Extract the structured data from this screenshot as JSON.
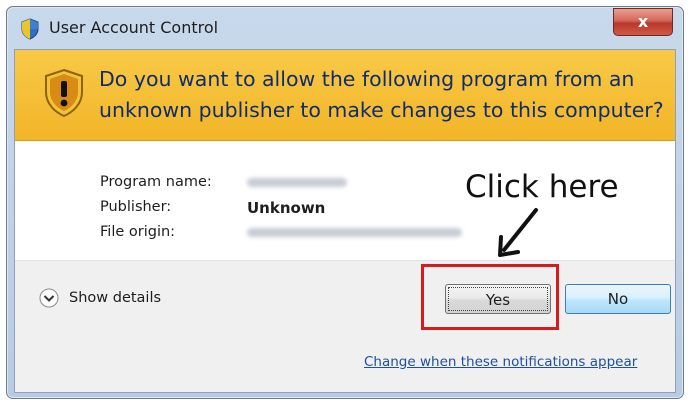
{
  "window": {
    "title": "User Account Control",
    "close_glyph": "x"
  },
  "banner": {
    "question": "Do you want to allow the following program from an unknown publisher to make changes to this computer?",
    "icon": "shield-warning-icon"
  },
  "program_info": {
    "program_name_label": "Program name:",
    "publisher_label": "Publisher:",
    "publisher_value": "Unknown",
    "file_origin_label": "File origin:"
  },
  "annotation": {
    "text": "Click here",
    "highlight_color": "#d51c1c"
  },
  "footer": {
    "show_details_label": "Show details",
    "yes_label": "Yes",
    "no_label": "No",
    "notifications_link": "Change when these notifications appear"
  },
  "colors": {
    "banner": "#f6c036",
    "question_text": "#0f2d6c",
    "link": "#1d4fa5"
  }
}
